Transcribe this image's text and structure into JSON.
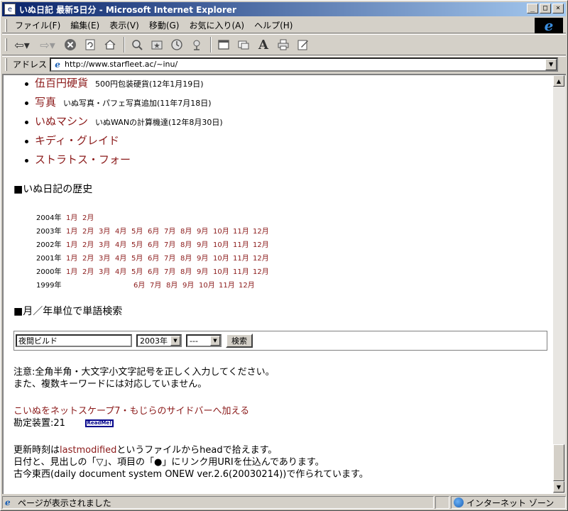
{
  "window": {
    "title": "いぬ日記 最新5日分 - Microsoft Internet Explorer",
    "title_icon": "ie-page-icon"
  },
  "menu": [
    "ファイル(F)",
    "編集(E)",
    "表示(V)",
    "移動(G)",
    "お気に入り(A)",
    "ヘルプ(H)"
  ],
  "address": {
    "label": "アドレス",
    "url": "http://www.starfleet.ac/~inu/"
  },
  "links": [
    {
      "title": "伍百円硬貨",
      "desc": "500円包装硬貨(12年1月19日)"
    },
    {
      "title": "写真",
      "desc": "いぬ写真・パフェ写真追加(11年7月18日)"
    },
    {
      "title": "いぬマシン",
      "desc": "いぬWANの計算機達(12年8月30日)"
    },
    {
      "title": "キディ・グレイド",
      "desc": ""
    },
    {
      "title": "ストラトス・フォー",
      "desc": ""
    }
  ],
  "history": {
    "heading": "■いぬ日記の歴史",
    "rows": [
      {
        "year": "2004年",
        "start": 0,
        "months": [
          "1月",
          "2月"
        ]
      },
      {
        "year": "2003年",
        "start": 0,
        "months": [
          "1月",
          "2月",
          "3月",
          "4月",
          "5月",
          "6月",
          "7月",
          "8月",
          "9月",
          "10月",
          "11月",
          "12月"
        ]
      },
      {
        "year": "2002年",
        "start": 0,
        "months": [
          "1月",
          "2月",
          "3月",
          "4月",
          "5月",
          "6月",
          "7月",
          "8月",
          "9月",
          "10月",
          "11月",
          "12月"
        ]
      },
      {
        "year": "2001年",
        "start": 0,
        "months": [
          "1月",
          "2月",
          "3月",
          "4月",
          "5月",
          "6月",
          "7月",
          "8月",
          "9月",
          "10月",
          "11月",
          "12月"
        ]
      },
      {
        "year": "2000年",
        "start": 0,
        "months": [
          "1月",
          "2月",
          "3月",
          "4月",
          "5月",
          "6月",
          "7月",
          "8月",
          "9月",
          "10月",
          "11月",
          "12月"
        ]
      },
      {
        "year": "1999年",
        "start": 5,
        "months": [
          "6月",
          "7月",
          "8月",
          "9月",
          "10月",
          "11月",
          "12月"
        ]
      }
    ]
  },
  "search": {
    "heading": "■月／年単位で単語検索",
    "query": "夜間ビルド",
    "year": "2003年",
    "month": "---",
    "button": "検索"
  },
  "notes": {
    "line1": "注意:全角半角・大文字小文字記号を正しく入力してください。",
    "line2": "また、複数キーワードには対応していません。"
  },
  "sidebar_link": "こいぬをネットスケープ7・もじらのサイドバーへ加える",
  "counter": {
    "label": "勘定装置:21",
    "badge": "ReadMe!"
  },
  "footer": {
    "line1_a": "更新時刻は",
    "line1_b": "lastmodified",
    "line1_c": "というファイルからheadで拾えます。",
    "line2": "日付と、見出しの「▽」、項目の「●」にリンク用URIを仕込んであります。",
    "line3": "古今東西(daily document system ONEW ver.2.6(20030214))で作られています。"
  },
  "status": {
    "text": "ページが表示されました",
    "zone": "インターネット ゾーン"
  }
}
